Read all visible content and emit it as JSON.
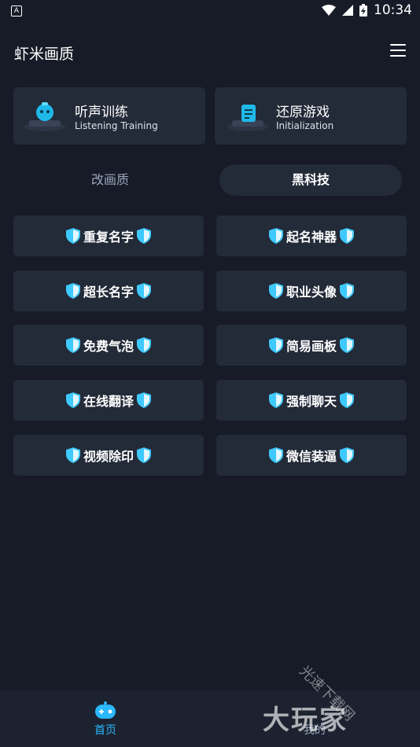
{
  "status_bar": {
    "notif_icon": "A",
    "time": "10:34"
  },
  "app": {
    "title": "虾米画质"
  },
  "cards": [
    {
      "title": "听声训练",
      "subtitle": "Listening Training",
      "icon": "bot-speaker-icon"
    },
    {
      "title": "还原游戏",
      "subtitle": "Initialization",
      "icon": "document-restore-icon"
    }
  ],
  "tabs": [
    {
      "label": "改画质",
      "active": false
    },
    {
      "label": "黑科技",
      "active": true
    }
  ],
  "buttons": [
    "重复名字",
    "起名神器",
    "超长名字",
    "职业头像",
    "免费气泡",
    "简易画板",
    "在线翻译",
    "强制聊天",
    "视频除印",
    "微信装逼"
  ],
  "nav": [
    {
      "label": "首页",
      "active": true,
      "color": "#2ab8ff"
    },
    {
      "label": "我的",
      "active": false
    }
  ],
  "watermark": {
    "main": "大玩家",
    "sub": "光速下载网"
  },
  "colors": {
    "background": "#161b27",
    "card": "#232a38",
    "accent": "#2ab8ff",
    "shield": "#3ec9ff"
  }
}
